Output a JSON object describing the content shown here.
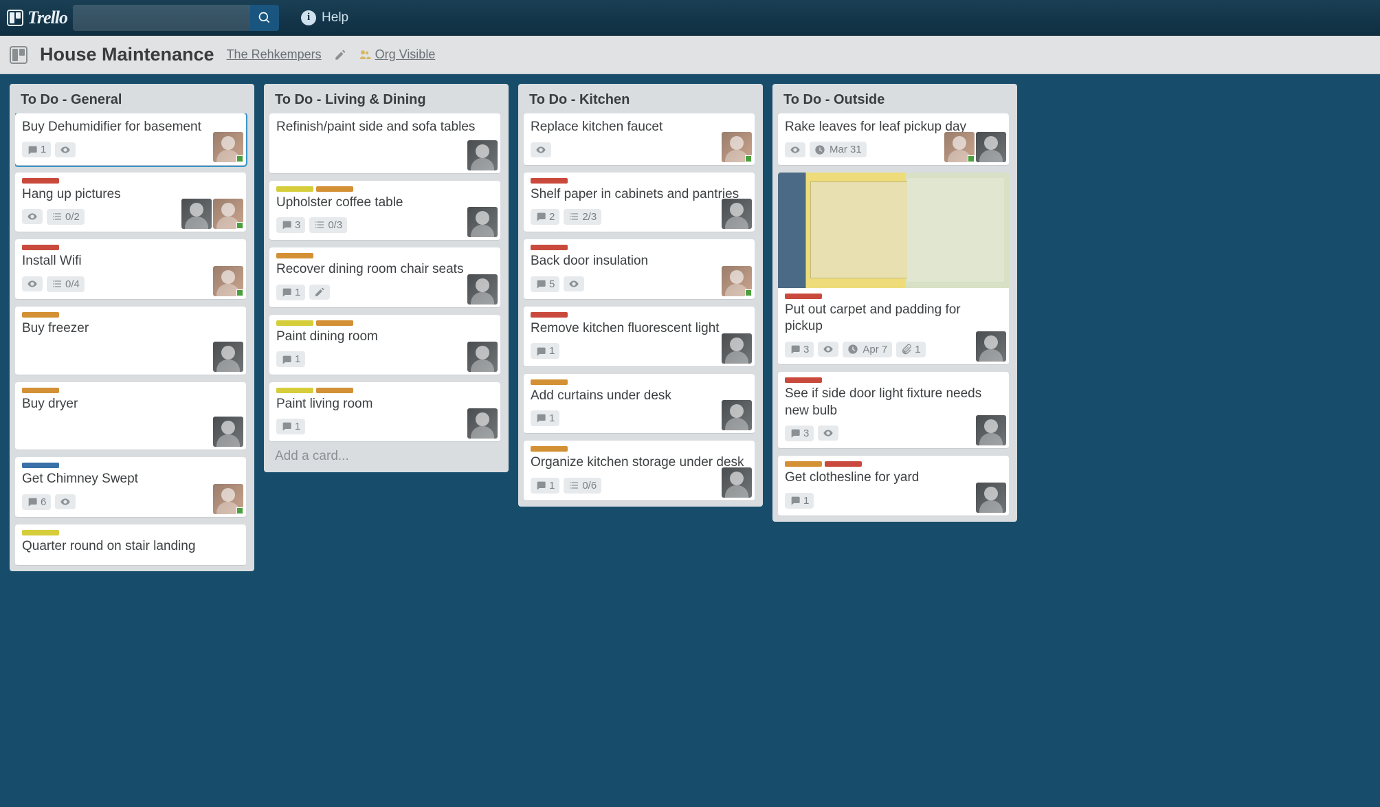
{
  "app": {
    "name": "Trello",
    "help": "Help"
  },
  "board": {
    "title": "House Maintenance",
    "org": "The Rehkempers",
    "visibility": "Org Visible"
  },
  "lists": [
    {
      "title": "To Do - General",
      "cards": [
        {
          "labels": [],
          "title": "Buy Dehumidifier for basement",
          "highlighted": true,
          "comments": 1,
          "watch": true,
          "members": [
            "male"
          ]
        },
        {
          "labels": [
            "red"
          ],
          "title": "Hang up pictures",
          "watch": true,
          "checklist": "0/2",
          "members": [
            "female",
            "male"
          ]
        },
        {
          "labels": [
            "red"
          ],
          "title": "Install Wifi",
          "watch": true,
          "checklist": "0/4",
          "members": [
            "male"
          ]
        },
        {
          "labels": [
            "orange"
          ],
          "title": "Buy freezer",
          "members": [
            "female"
          ]
        },
        {
          "labels": [
            "orange"
          ],
          "title": "Buy dryer",
          "members": [
            "female"
          ]
        },
        {
          "labels": [
            "blue"
          ],
          "title": "Get Chimney Swept",
          "comments": 6,
          "watch": true,
          "members": [
            "male"
          ]
        },
        {
          "labels": [
            "yellow"
          ],
          "title": "Quarter round on stair landing"
        }
      ]
    },
    {
      "title": "To Do - Living & Dining",
      "add_card": "Add a card...",
      "cards": [
        {
          "labels": [],
          "title": "Refinish/paint side and sofa tables",
          "members": [
            "female"
          ]
        },
        {
          "labels": [
            "yellow",
            "orange"
          ],
          "title": "Upholster coffee table",
          "comments": 3,
          "checklist": "0/3",
          "members": [
            "female"
          ]
        },
        {
          "labels": [
            "orange"
          ],
          "title": "Recover dining room chair seats",
          "comments": 1,
          "edit": true,
          "members": [
            "female"
          ]
        },
        {
          "labels": [
            "yellow",
            "orange"
          ],
          "title": "Paint dining room",
          "comments": 1,
          "members": [
            "female"
          ]
        },
        {
          "labels": [
            "yellow",
            "orange"
          ],
          "title": "Paint living room",
          "comments": 1,
          "members": [
            "female"
          ]
        }
      ]
    },
    {
      "title": "To Do - Kitchen",
      "cards": [
        {
          "labels": [],
          "title": "Replace kitchen faucet",
          "watch": true,
          "members": [
            "male"
          ]
        },
        {
          "labels": [
            "red"
          ],
          "title": "Shelf paper in cabinets and pantries",
          "comments": 2,
          "checklist": "2/3",
          "members": [
            "female"
          ]
        },
        {
          "labels": [
            "red"
          ],
          "title": "Back door insulation",
          "comments": 5,
          "watch": true,
          "members": [
            "male"
          ]
        },
        {
          "labels": [
            "red"
          ],
          "title": "Remove kitchen fluorescent light",
          "comments": 1,
          "members": [
            "female"
          ]
        },
        {
          "labels": [
            "orange"
          ],
          "title": "Add curtains under desk",
          "comments": 1,
          "members": [
            "female"
          ]
        },
        {
          "labels": [
            "orange"
          ],
          "title": "Organize kitchen storage under desk",
          "comments": 1,
          "checklist": "0/6",
          "members": [
            "female"
          ]
        }
      ]
    },
    {
      "title": "To Do - Outside",
      "cards": [
        {
          "labels": [],
          "title": "Rake leaves for leaf pickup day",
          "watch": true,
          "date": "Mar 31",
          "members": [
            "male",
            "female"
          ]
        },
        {
          "labels": [
            "red"
          ],
          "cover": true,
          "title": "Put out carpet and padding for pickup",
          "comments": 3,
          "watch": true,
          "date": "Apr 7",
          "attach": 1,
          "members": [
            "female"
          ]
        },
        {
          "labels": [
            "red"
          ],
          "title": "See if side door light fixture needs new bulb",
          "comments": 3,
          "watch": true,
          "members": [
            "female"
          ]
        },
        {
          "labels": [
            "orange",
            "red"
          ],
          "title": "Get clothesline for yard",
          "comments": 1,
          "members": [
            "female"
          ]
        }
      ]
    }
  ]
}
